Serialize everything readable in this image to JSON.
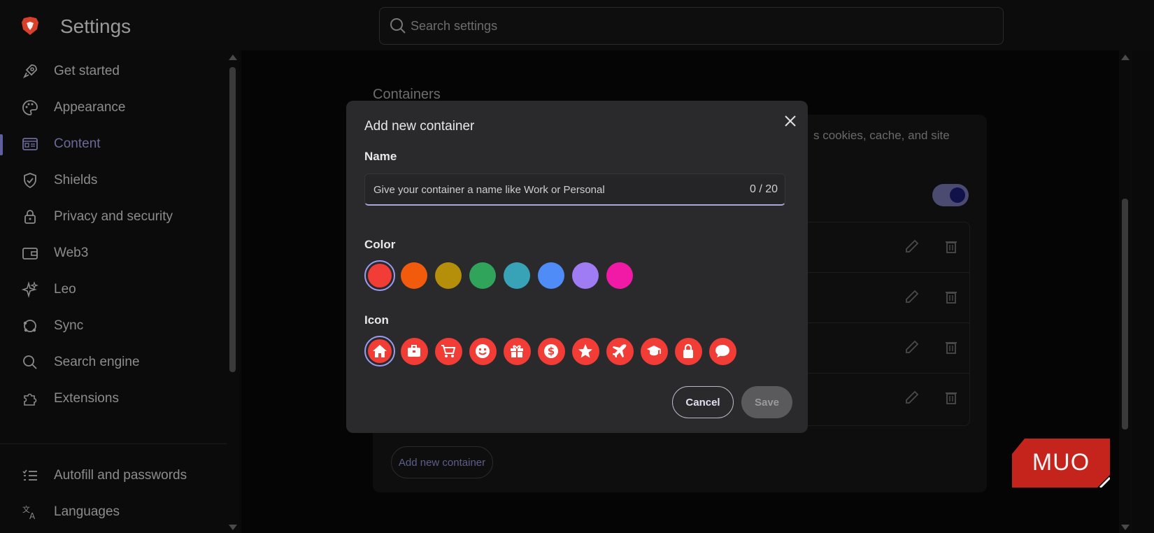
{
  "header": {
    "title": "Settings",
    "search_placeholder": "Search settings"
  },
  "sidebar": {
    "items": [
      {
        "label": "Get started",
        "icon": "rocket-icon"
      },
      {
        "label": "Appearance",
        "icon": "palette-icon"
      },
      {
        "label": "Content",
        "icon": "content-icon",
        "active": true
      },
      {
        "label": "Shields",
        "icon": "shield-icon"
      },
      {
        "label": "Privacy and security",
        "icon": "lock-icon"
      },
      {
        "label": "Web3",
        "icon": "wallet-icon"
      },
      {
        "label": "Leo",
        "icon": "sparkle-icon"
      },
      {
        "label": "Sync",
        "icon": "sync-icon"
      },
      {
        "label": "Search engine",
        "icon": "search-icon"
      },
      {
        "label": "Extensions",
        "icon": "puzzle-icon"
      }
    ],
    "bottom_items": [
      {
        "label": "Autofill and passwords",
        "icon": "list-icon"
      },
      {
        "label": "Languages",
        "icon": "translate-icon"
      }
    ]
  },
  "main": {
    "section_title": "Containers",
    "description_fragment": "s cookies, cache, and site",
    "add_button_label": "Add new container"
  },
  "modal": {
    "title": "Add new container",
    "name_label": "Name",
    "name_placeholder": "Give your container a name like Work or Personal",
    "name_counter": "0 / 20",
    "color_label": "Color",
    "colors": [
      "#f23c36",
      "#f25a0c",
      "#b58e0a",
      "#2fa45a",
      "#38a2b6",
      "#4f8cf8",
      "#a07cf4",
      "#f01aa6"
    ],
    "selected_color": 0,
    "icon_label": "Icon",
    "icons": [
      "home-icon",
      "briefcase-icon",
      "cart-icon",
      "smiley-icon",
      "gift-icon",
      "dollar-icon",
      "star-icon",
      "airplane-icon",
      "graduation-icon",
      "lock-icon",
      "chat-icon"
    ],
    "selected_icon": 0,
    "cancel_label": "Cancel",
    "save_label": "Save"
  },
  "watermark": {
    "text": "MUO",
    "color": "#c4241c"
  }
}
